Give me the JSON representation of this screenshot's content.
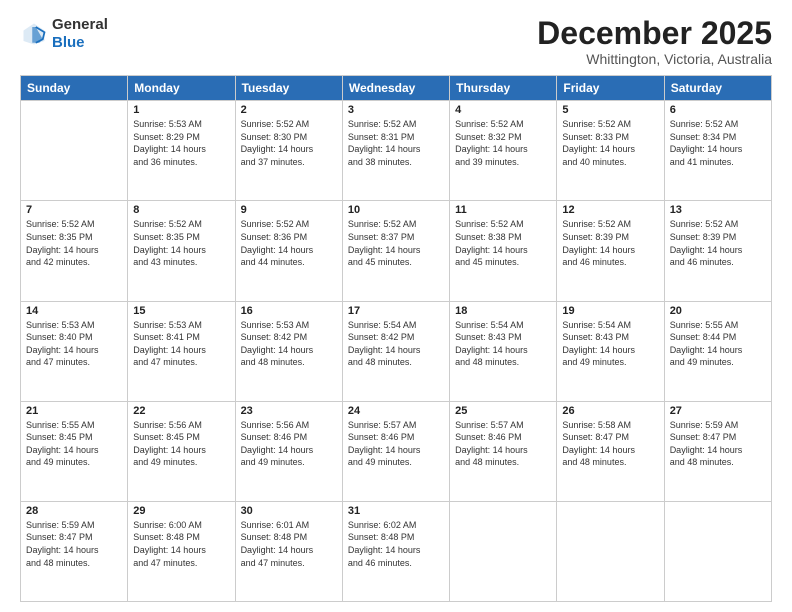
{
  "header": {
    "logo_line1": "General",
    "logo_line2": "Blue",
    "month": "December 2025",
    "location": "Whittington, Victoria, Australia"
  },
  "weekdays": [
    "Sunday",
    "Monday",
    "Tuesday",
    "Wednesday",
    "Thursday",
    "Friday",
    "Saturday"
  ],
  "weeks": [
    [
      {
        "day": "",
        "info": ""
      },
      {
        "day": "1",
        "info": "Sunrise: 5:53 AM\nSunset: 8:29 PM\nDaylight: 14 hours\nand 36 minutes."
      },
      {
        "day": "2",
        "info": "Sunrise: 5:52 AM\nSunset: 8:30 PM\nDaylight: 14 hours\nand 37 minutes."
      },
      {
        "day": "3",
        "info": "Sunrise: 5:52 AM\nSunset: 8:31 PM\nDaylight: 14 hours\nand 38 minutes."
      },
      {
        "day": "4",
        "info": "Sunrise: 5:52 AM\nSunset: 8:32 PM\nDaylight: 14 hours\nand 39 minutes."
      },
      {
        "day": "5",
        "info": "Sunrise: 5:52 AM\nSunset: 8:33 PM\nDaylight: 14 hours\nand 40 minutes."
      },
      {
        "day": "6",
        "info": "Sunrise: 5:52 AM\nSunset: 8:34 PM\nDaylight: 14 hours\nand 41 minutes."
      }
    ],
    [
      {
        "day": "7",
        "info": "Sunrise: 5:52 AM\nSunset: 8:35 PM\nDaylight: 14 hours\nand 42 minutes."
      },
      {
        "day": "8",
        "info": "Sunrise: 5:52 AM\nSunset: 8:35 PM\nDaylight: 14 hours\nand 43 minutes."
      },
      {
        "day": "9",
        "info": "Sunrise: 5:52 AM\nSunset: 8:36 PM\nDaylight: 14 hours\nand 44 minutes."
      },
      {
        "day": "10",
        "info": "Sunrise: 5:52 AM\nSunset: 8:37 PM\nDaylight: 14 hours\nand 45 minutes."
      },
      {
        "day": "11",
        "info": "Sunrise: 5:52 AM\nSunset: 8:38 PM\nDaylight: 14 hours\nand 45 minutes."
      },
      {
        "day": "12",
        "info": "Sunrise: 5:52 AM\nSunset: 8:39 PM\nDaylight: 14 hours\nand 46 minutes."
      },
      {
        "day": "13",
        "info": "Sunrise: 5:52 AM\nSunset: 8:39 PM\nDaylight: 14 hours\nand 46 minutes."
      }
    ],
    [
      {
        "day": "14",
        "info": "Sunrise: 5:53 AM\nSunset: 8:40 PM\nDaylight: 14 hours\nand 47 minutes."
      },
      {
        "day": "15",
        "info": "Sunrise: 5:53 AM\nSunset: 8:41 PM\nDaylight: 14 hours\nand 47 minutes."
      },
      {
        "day": "16",
        "info": "Sunrise: 5:53 AM\nSunset: 8:42 PM\nDaylight: 14 hours\nand 48 minutes."
      },
      {
        "day": "17",
        "info": "Sunrise: 5:54 AM\nSunset: 8:42 PM\nDaylight: 14 hours\nand 48 minutes."
      },
      {
        "day": "18",
        "info": "Sunrise: 5:54 AM\nSunset: 8:43 PM\nDaylight: 14 hours\nand 48 minutes."
      },
      {
        "day": "19",
        "info": "Sunrise: 5:54 AM\nSunset: 8:43 PM\nDaylight: 14 hours\nand 49 minutes."
      },
      {
        "day": "20",
        "info": "Sunrise: 5:55 AM\nSunset: 8:44 PM\nDaylight: 14 hours\nand 49 minutes."
      }
    ],
    [
      {
        "day": "21",
        "info": "Sunrise: 5:55 AM\nSunset: 8:45 PM\nDaylight: 14 hours\nand 49 minutes."
      },
      {
        "day": "22",
        "info": "Sunrise: 5:56 AM\nSunset: 8:45 PM\nDaylight: 14 hours\nand 49 minutes."
      },
      {
        "day": "23",
        "info": "Sunrise: 5:56 AM\nSunset: 8:46 PM\nDaylight: 14 hours\nand 49 minutes."
      },
      {
        "day": "24",
        "info": "Sunrise: 5:57 AM\nSunset: 8:46 PM\nDaylight: 14 hours\nand 49 minutes."
      },
      {
        "day": "25",
        "info": "Sunrise: 5:57 AM\nSunset: 8:46 PM\nDaylight: 14 hours\nand 48 minutes."
      },
      {
        "day": "26",
        "info": "Sunrise: 5:58 AM\nSunset: 8:47 PM\nDaylight: 14 hours\nand 48 minutes."
      },
      {
        "day": "27",
        "info": "Sunrise: 5:59 AM\nSunset: 8:47 PM\nDaylight: 14 hours\nand 48 minutes."
      }
    ],
    [
      {
        "day": "28",
        "info": "Sunrise: 5:59 AM\nSunset: 8:47 PM\nDaylight: 14 hours\nand 48 minutes."
      },
      {
        "day": "29",
        "info": "Sunrise: 6:00 AM\nSunset: 8:48 PM\nDaylight: 14 hours\nand 47 minutes."
      },
      {
        "day": "30",
        "info": "Sunrise: 6:01 AM\nSunset: 8:48 PM\nDaylight: 14 hours\nand 47 minutes."
      },
      {
        "day": "31",
        "info": "Sunrise: 6:02 AM\nSunset: 8:48 PM\nDaylight: 14 hours\nand 46 minutes."
      },
      {
        "day": "",
        "info": ""
      },
      {
        "day": "",
        "info": ""
      },
      {
        "day": "",
        "info": ""
      }
    ]
  ]
}
